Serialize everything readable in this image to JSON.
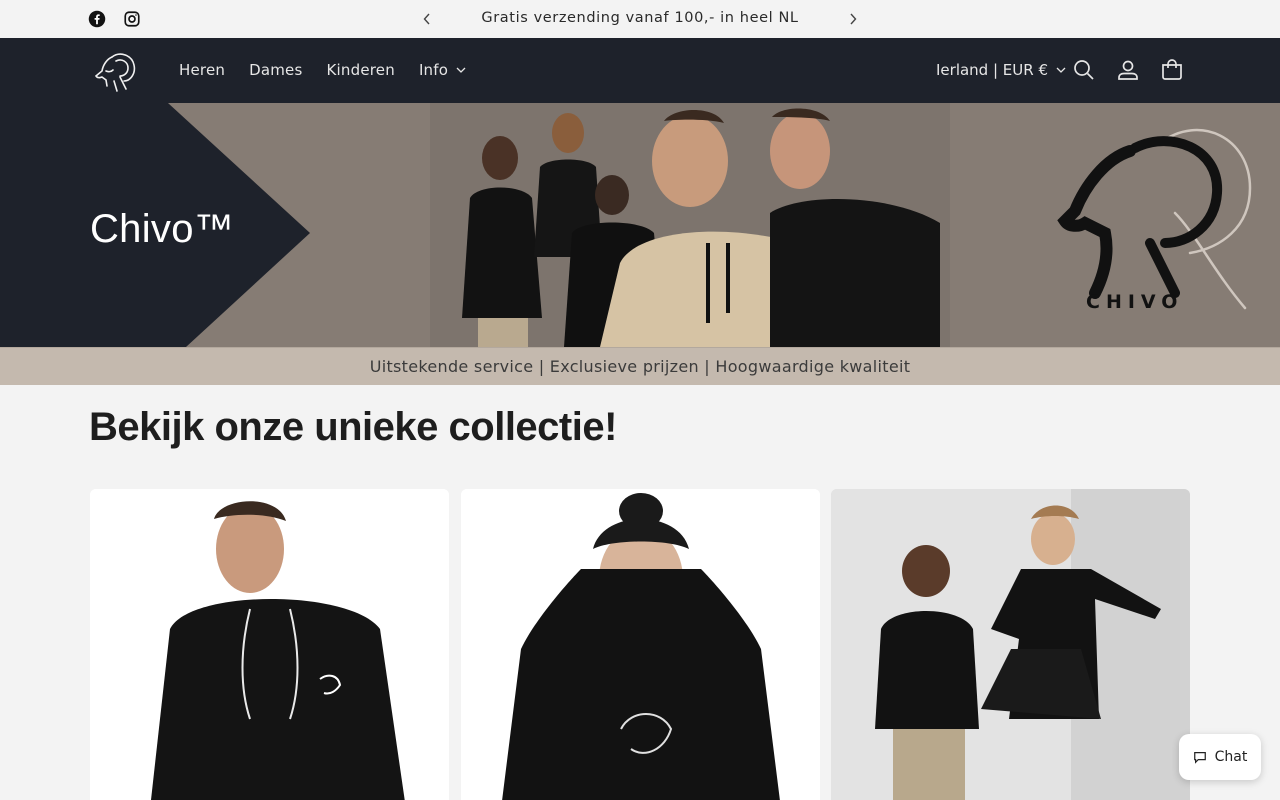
{
  "announcement": {
    "text": "Gratis verzending vanaf 100,- in heel NL",
    "social_icons": [
      "facebook-icon",
      "instagram-icon"
    ]
  },
  "header": {
    "nav": [
      {
        "label": "Heren"
      },
      {
        "label": "Dames"
      },
      {
        "label": "Kinderen"
      },
      {
        "label": "Info"
      }
    ],
    "country_selector": "Ierland | EUR €",
    "icons": [
      "search-icon",
      "account-icon",
      "cart-icon"
    ]
  },
  "hero": {
    "title": "Chivo™",
    "brand_wordmark": "CHIVO"
  },
  "tagline": "Uitstekende service | Exclusieve prijzen | Hoogwaardige kwaliteit",
  "collection": {
    "title": "Bekijk onze unieke collectie!"
  },
  "chat": {
    "label": "Chat"
  },
  "colors": {
    "header_bg": "#1e222b",
    "hero_bg": "#857b73",
    "tagline_bg": "#c4b9ae",
    "page_bg": "#f3f3f3"
  }
}
